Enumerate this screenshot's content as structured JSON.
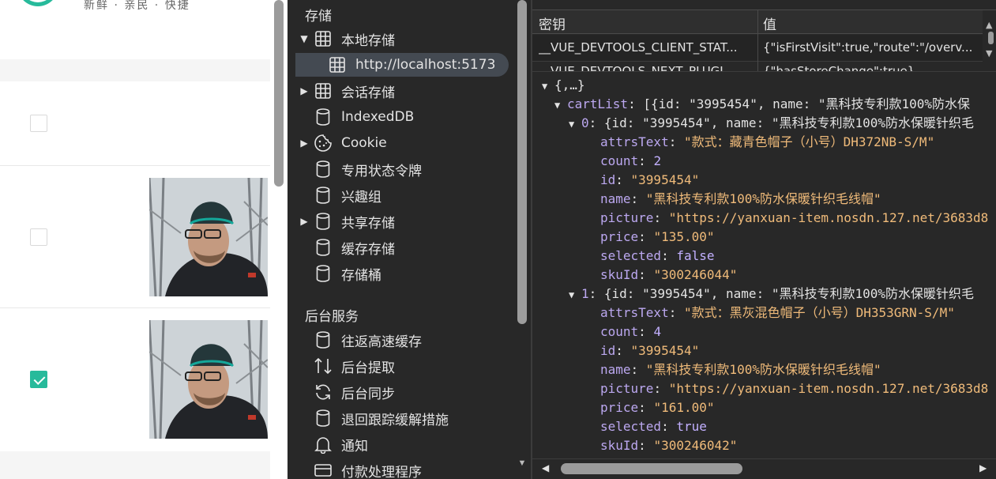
{
  "page": {
    "tagline": "新鲜 · 亲民 · 快捷",
    "brand_color": "#27ba9b",
    "items": [
      {
        "checked": false,
        "has_image": false
      },
      {
        "checked": false,
        "has_image": true
      },
      {
        "checked": true,
        "has_image": true
      }
    ]
  },
  "sidebar": {
    "storage_heading": "存储",
    "storage_items": [
      {
        "label": "本地存储",
        "icon": "grid-icon",
        "expanded": true
      },
      {
        "label": "http://localhost:5173",
        "icon": "grid-icon",
        "selected": true
      },
      {
        "label": "会话存储",
        "icon": "grid-icon",
        "expanded": false
      },
      {
        "label": "IndexedDB",
        "icon": "database-icon"
      },
      {
        "label": "Cookie",
        "icon": "cookie-icon",
        "expanded": false
      },
      {
        "label": "专用状态令牌",
        "icon": "database-icon"
      },
      {
        "label": "兴趣组",
        "icon": "database-icon"
      },
      {
        "label": "共享存储",
        "icon": "database-icon",
        "expanded": false
      },
      {
        "label": "缓存存储",
        "icon": "database-icon"
      },
      {
        "label": "存储桶",
        "icon": "database-icon"
      }
    ],
    "background_heading": "后台服务",
    "background_items": [
      {
        "label": "往返高速缓存",
        "icon": "database-icon"
      },
      {
        "label": "后台提取",
        "icon": "up-down-arrows-icon"
      },
      {
        "label": "后台同步",
        "icon": "sync-icon"
      },
      {
        "label": "退回跟踪缓解措施",
        "icon": "database-icon"
      },
      {
        "label": "通知",
        "icon": "bell-icon"
      },
      {
        "label": "付款处理程序",
        "icon": "card-icon"
      }
    ]
  },
  "table": {
    "col_key": "密钥",
    "col_value": "值",
    "rows": [
      {
        "key": "__VUE_DEVTOOLS_CLIENT_STAT...",
        "value": "{\"isFirstVisit\":true,\"route\":\"/overv..."
      },
      {
        "key": "__VUE_DEVTOOLS_NEXT_PLUGI...",
        "value": "{\"hasStoreChange\":true}"
      }
    ]
  },
  "json": {
    "root": "{,…}",
    "cartList_key": "cartList",
    "cartList_summary": "[{id: \"3995454\", name: \"黑科技专利款100%防水保",
    "items": [
      {
        "index_label": "0",
        "summary": "{id: \"3995454\", name: \"黑科技专利款100%防水保暖针织毛",
        "fields": [
          {
            "k": "attrsText",
            "v": "\"款式：藏青色帽子（小号）DH372NB-S/M\"",
            "t": "s"
          },
          {
            "k": "count",
            "v": "2",
            "t": "n"
          },
          {
            "k": "id",
            "v": "\"3995454\"",
            "t": "s"
          },
          {
            "k": "name",
            "v": "\"黑科技专利款100%防水保暖针织毛线帽\"",
            "t": "s"
          },
          {
            "k": "picture",
            "v": "\"https://yanxuan-item.nosdn.127.net/3683d8",
            "t": "s"
          },
          {
            "k": "price",
            "v": "\"135.00\"",
            "t": "s"
          },
          {
            "k": "selected",
            "v": "false",
            "t": "b"
          },
          {
            "k": "skuId",
            "v": "\"300246044\"",
            "t": "s"
          }
        ]
      },
      {
        "index_label": "1",
        "summary": "{id: \"3995454\", name: \"黑科技专利款100%防水保暖针织毛",
        "fields": [
          {
            "k": "attrsText",
            "v": "\"款式：黑灰混色帽子（小号）DH353GRN-S/M\"",
            "t": "s"
          },
          {
            "k": "count",
            "v": "4",
            "t": "n"
          },
          {
            "k": "id",
            "v": "\"3995454\"",
            "t": "s"
          },
          {
            "k": "name",
            "v": "\"黑科技专利款100%防水保暖针织毛线帽\"",
            "t": "s"
          },
          {
            "k": "picture",
            "v": "\"https://yanxuan-item.nosdn.127.net/3683d8",
            "t": "s"
          },
          {
            "k": "price",
            "v": "\"161.00\"",
            "t": "s"
          },
          {
            "k": "selected",
            "v": "true",
            "t": "b"
          },
          {
            "k": "skuId",
            "v": "\"300246042\"",
            "t": "s"
          }
        ]
      }
    ]
  }
}
